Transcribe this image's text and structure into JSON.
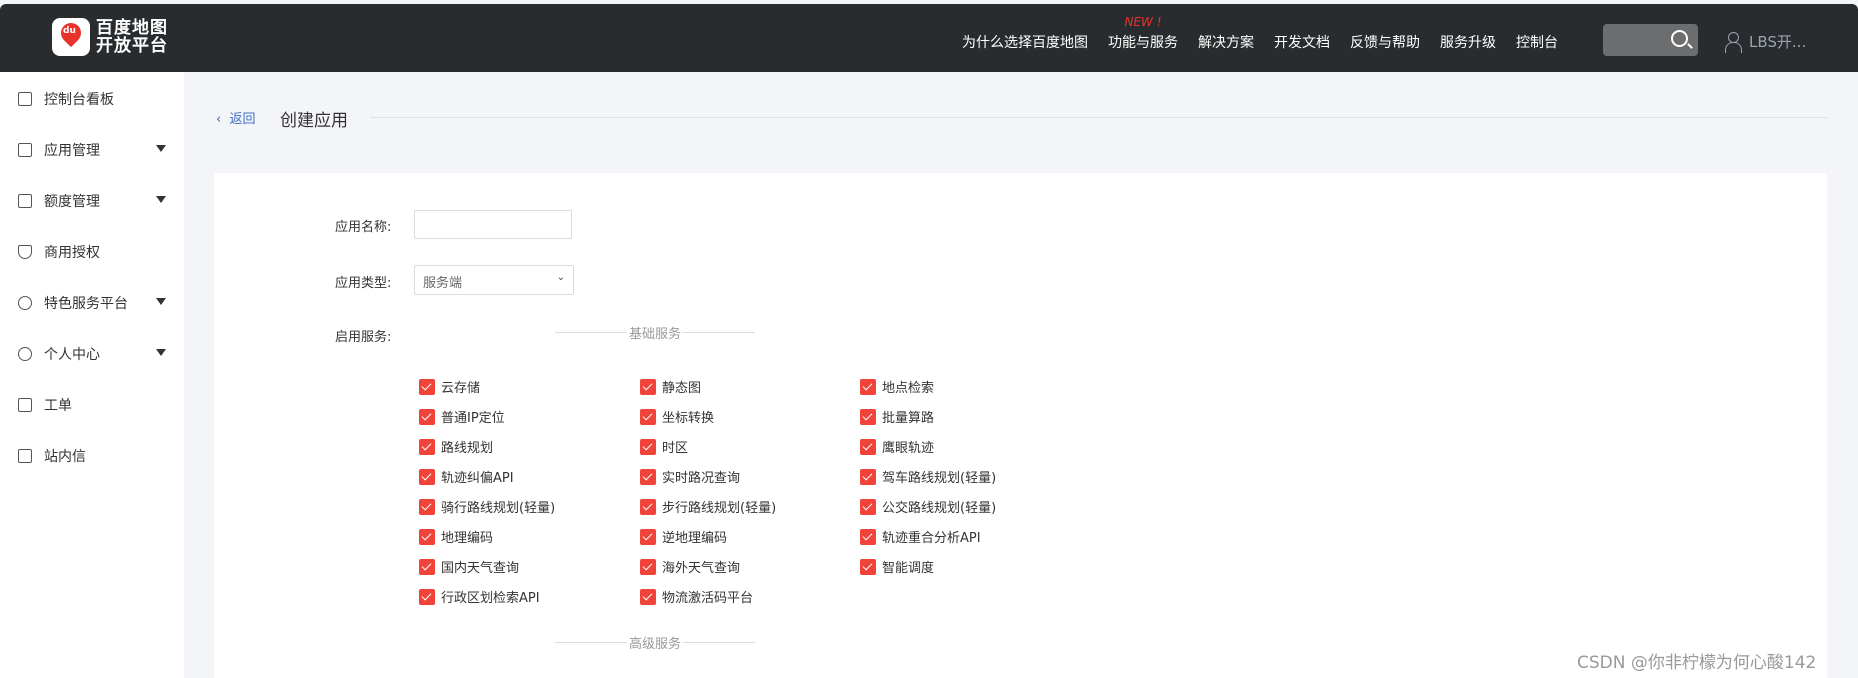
{
  "header": {
    "logo_line1": "百度地图",
    "logo_line2": "开放平台",
    "logo_badge": "du",
    "nav": [
      "为什么选择百度地图",
      "功能与服务",
      "解决方案",
      "开发文档",
      "反馈与帮助",
      "服务升级",
      "控制台"
    ],
    "new_badge": "NEW !",
    "user": "LBS开..."
  },
  "sidebar": {
    "items": [
      {
        "label": "控制台看板",
        "icon": "dashboard-icon",
        "caret": false
      },
      {
        "label": "应用管理",
        "icon": "grid-icon",
        "caret": true
      },
      {
        "label": "额度管理",
        "icon": "sliders-icon",
        "caret": true
      },
      {
        "label": "商用授权",
        "icon": "shield-icon",
        "caret": false
      },
      {
        "label": "特色服务平台",
        "icon": "badge-icon",
        "caret": true
      },
      {
        "label": "个人中心",
        "icon": "user-circle-icon",
        "caret": true
      },
      {
        "label": "工单",
        "icon": "clipboard-icon",
        "caret": false
      },
      {
        "label": "站内信",
        "icon": "mail-icon",
        "caret": false
      }
    ]
  },
  "page": {
    "back": "返回",
    "title": "创建应用"
  },
  "form": {
    "name_label": "应用名称:",
    "name_value": "",
    "type_label": "应用类型:",
    "type_value": "服务端",
    "services_label": "启用服务:",
    "basic_section": "基础服务",
    "advanced_section": "高级服务",
    "services": [
      [
        "云存储",
        "静态图",
        "地点检索"
      ],
      [
        "普通IP定位",
        "坐标转换",
        "批量算路"
      ],
      [
        "路线规划",
        "时区",
        "鹰眼轨迹"
      ],
      [
        "轨迹纠偏API",
        "实时路况查询",
        "驾车路线规划(轻量)"
      ],
      [
        "骑行路线规划(轻量)",
        "步行路线规划(轻量)",
        "公交路线规划(轻量)"
      ],
      [
        "地理编码",
        "逆地理编码",
        "轨迹重合分析API"
      ],
      [
        "国内天气查询",
        "海外天气查询",
        "智能调度"
      ],
      [
        "行政区划检索API",
        "物流激活码平台",
        null
      ]
    ]
  },
  "watermark": "CSDN @你非柠檬为何心酸142",
  "colors": {
    "header": "#292c2e",
    "checkbox": "#f0433a",
    "link": "#3f6dc1"
  }
}
